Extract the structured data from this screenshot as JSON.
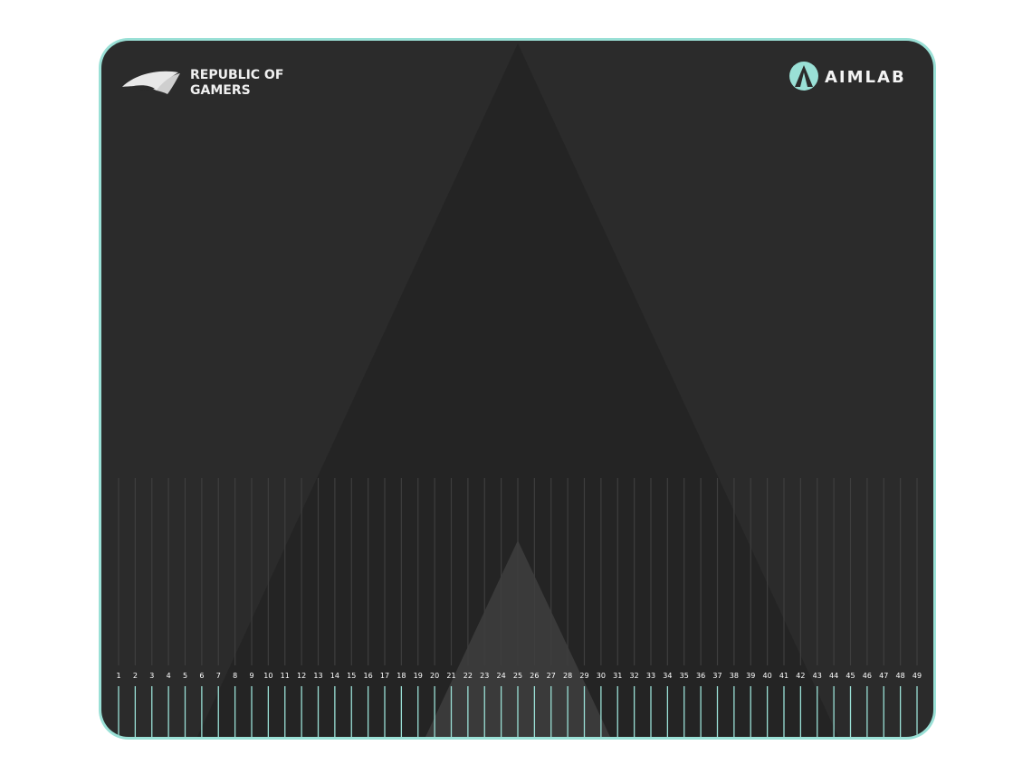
{
  "product": {
    "brand_line1": "REPUBLIC OF",
    "brand_line2": "GAMERS",
    "partner": "AIMLAB",
    "accent_color": "#9ae0d6",
    "ruler_numbers": [
      "1",
      "2",
      "3",
      "4",
      "5",
      "6",
      "7",
      "8",
      "9",
      "10",
      "11",
      "12",
      "13",
      "14",
      "15",
      "16",
      "17",
      "18",
      "19",
      "20",
      "21",
      "22",
      "23",
      "24",
      "25",
      "26",
      "27",
      "28",
      "29",
      "30",
      "31",
      "32",
      "33",
      "34",
      "35",
      "36",
      "37",
      "38",
      "39",
      "40",
      "41",
      "42",
      "43",
      "44",
      "45",
      "46",
      "47",
      "48",
      "49"
    ]
  },
  "icons": {
    "brand_logo": "rog-eye-icon",
    "partner_logo": "aimlab-triangle-icon"
  }
}
